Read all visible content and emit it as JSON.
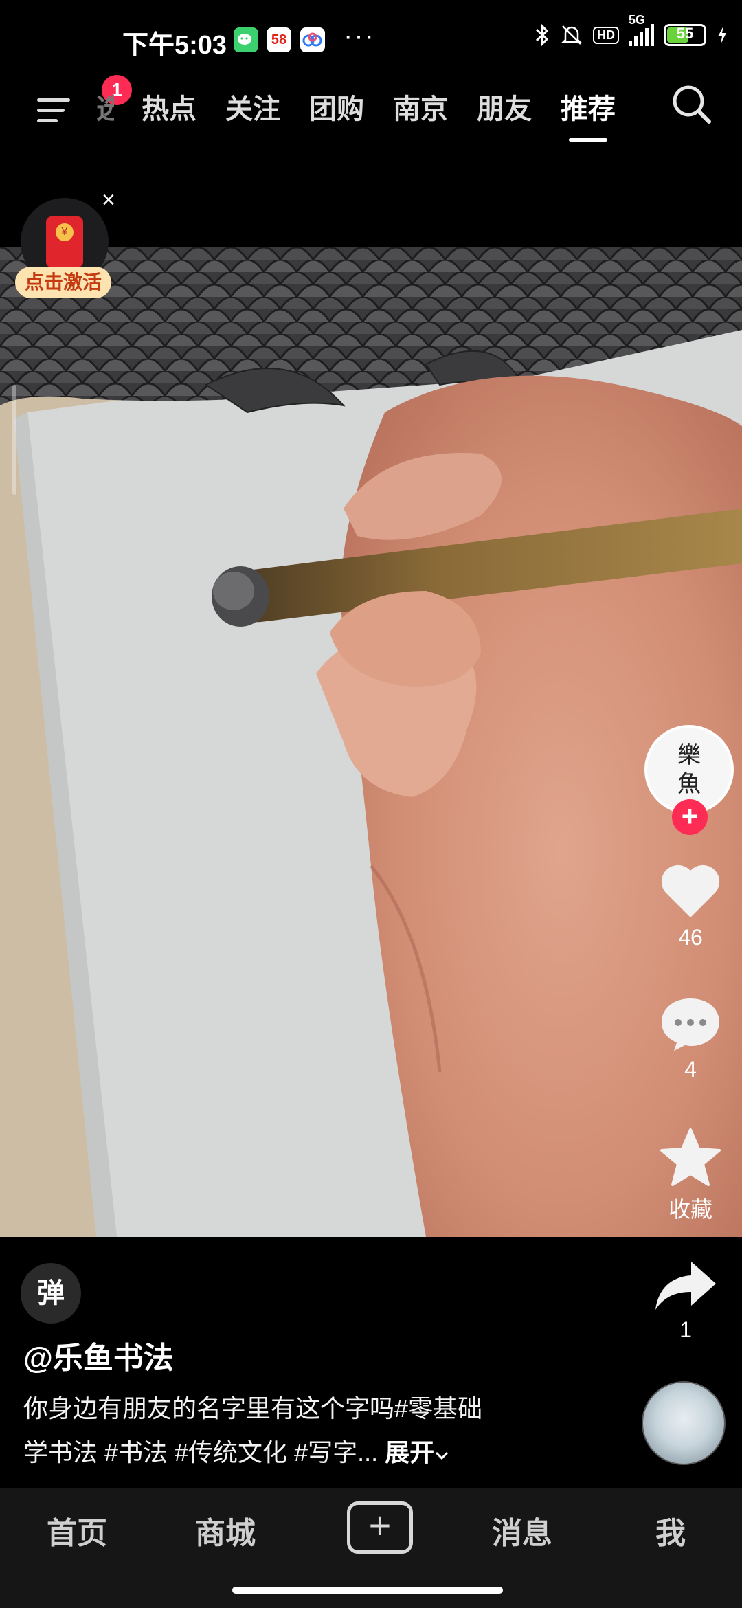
{
  "status_bar": {
    "time": "下午5:03",
    "apps": [
      "58",
      "同城"
    ],
    "overflow": "···",
    "network": "5G",
    "hd": "HD",
    "battery": "55"
  },
  "top_nav": {
    "menu_badge": "1",
    "tabs": [
      {
        "label": "选",
        "state": "faded"
      },
      {
        "label": "热点"
      },
      {
        "label": "关注"
      },
      {
        "label": "团购"
      },
      {
        "label": "南京"
      },
      {
        "label": "朋友"
      },
      {
        "label": "推荐",
        "state": "active"
      }
    ],
    "search_icon": "search-icon"
  },
  "promo": {
    "label": "点击激活",
    "close": "×"
  },
  "right_rail": {
    "author_avatar_text": [
      "樂",
      "魚"
    ],
    "follow": "+",
    "likes": "46",
    "comments": "4",
    "favorite_label": "收藏",
    "shares": "1"
  },
  "post": {
    "danmu": "弹",
    "author": "@乐鱼书法",
    "description_line1": "你身边有朋友的名字里有这个字吗#零基础",
    "description_line2": "学书法 #书法 #传统文化 #写字...",
    "expand": "展开"
  },
  "bottom_nav": {
    "home": "首页",
    "mall": "商城",
    "create": "+",
    "messages": "消息",
    "me": "我"
  },
  "colors": {
    "accent": "#fe2c55",
    "background": "#000000",
    "nav_background": "#161616"
  }
}
